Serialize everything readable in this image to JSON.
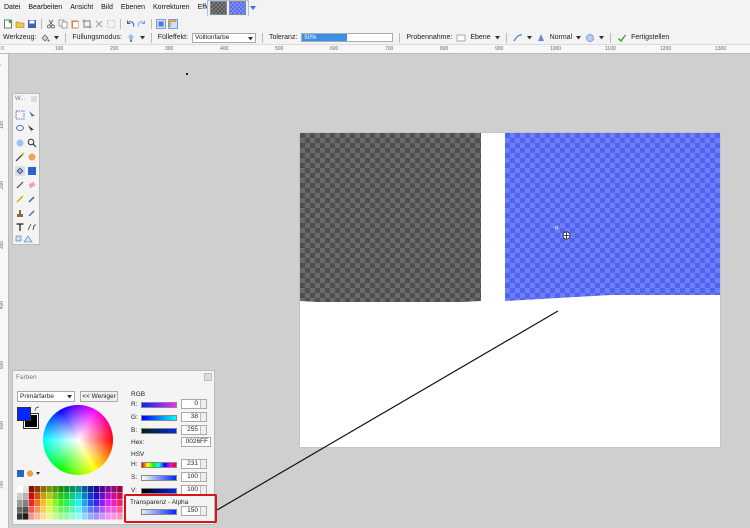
{
  "menubar": {
    "items": [
      "Datei",
      "Bearbeiten",
      "Ansicht",
      "Bild",
      "Ebenen",
      "Korrekturen",
      "Effekte"
    ]
  },
  "toolbar2": {
    "tool_label": "Werkzeug:",
    "fill_mode_label": "Füllungsmodus:",
    "fill_effect_label": "Fülleffekt:",
    "fill_effect_value": "Volltonfarbe",
    "tolerance_label": "Toleranz:",
    "tolerance_value": "50%",
    "tolerance_fraction": 0.5,
    "sampling_label": "Probennahme:",
    "sampling_value": "Ebene",
    "blend_value": "Normal",
    "finish_label": "Fertigstellen"
  },
  "ruler_top": [
    "0",
    "100",
    "200",
    "300",
    "400",
    "500",
    "600",
    "700",
    "800",
    "900",
    "1000",
    "1100",
    "1200",
    "1300"
  ],
  "ruler_left": [
    "0",
    "100",
    "200",
    "300",
    "400",
    "500",
    "600",
    "700"
  ],
  "tools_panel": {
    "title": "W..."
  },
  "colors_panel": {
    "title": "Farben",
    "primary_select": "Primärfarbe",
    "fewer_button": "<< Weniger",
    "rgb_label": "RGB",
    "r_label": "R:",
    "r_value": "0",
    "g_label": "G:",
    "g_value": "38",
    "b_label": "B:",
    "b_value": "255",
    "hex_label": "Hex:",
    "hex_value": "0026FF",
    "hsv_label": "HSV",
    "h_label": "H:",
    "h_value": "231",
    "s_label": "S:",
    "s_value": "100",
    "v_label": "V:",
    "v_value": "100",
    "alpha_label": "Transparenz - Alpha",
    "alpha_value": "150"
  },
  "colors": {
    "primary": "#0026FF",
    "secondary": "#000000",
    "callout": "#d6141a",
    "tolerance_fill": "#3c8ee6"
  }
}
